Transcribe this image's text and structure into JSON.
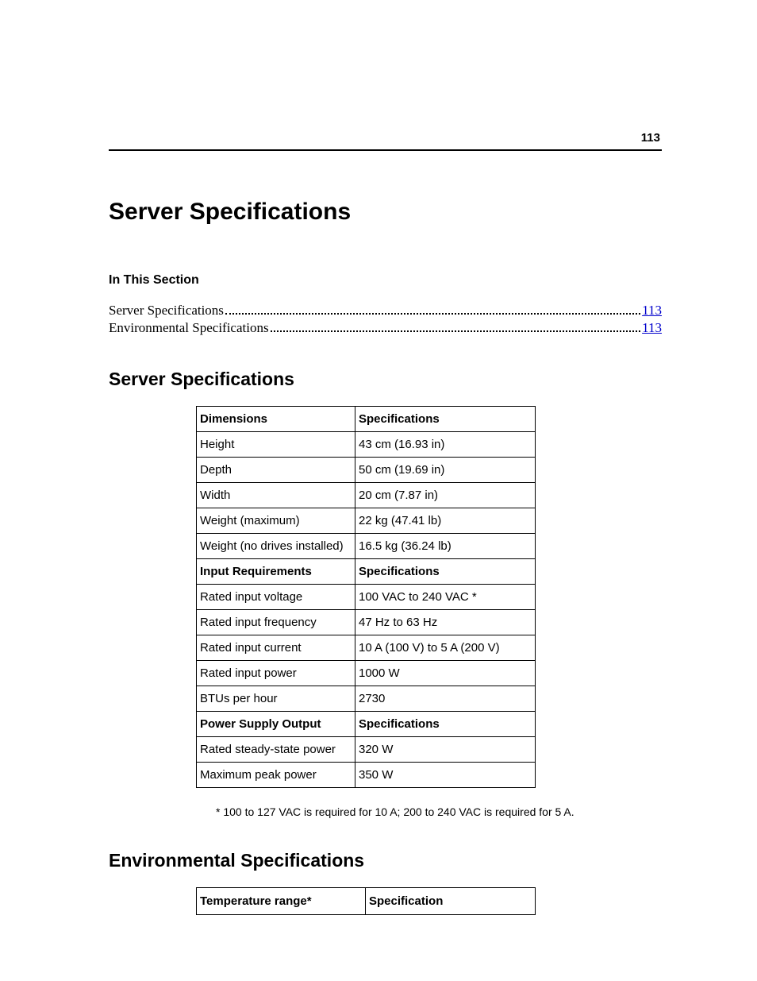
{
  "page_number": "113",
  "title": "Server Specifications",
  "in_this_section_label": "In This Section",
  "toc": [
    {
      "label": "Server Specifications",
      "page": "113"
    },
    {
      "label": "Environmental Specifications",
      "page": "113"
    }
  ],
  "heading_server_specs": "Server Specifications",
  "spec_table": [
    {
      "c1": "Dimensions",
      "c2": "Specifications",
      "header": true
    },
    {
      "c1": "Height",
      "c2": "43 cm (16.93 in)"
    },
    {
      "c1": "Depth",
      "c2": "50 cm (19.69 in)"
    },
    {
      "c1": "Width",
      "c2": "20 cm (7.87 in)"
    },
    {
      "c1": "Weight (maximum)",
      "c2": "22 kg (47.41 lb)"
    },
    {
      "c1": "Weight (no drives installed)",
      "c2": "16.5 kg (36.24 lb)"
    },
    {
      "c1": "Input Requirements",
      "c2": "Specifications",
      "header": true
    },
    {
      "c1": "Rated input voltage",
      "c2": "100 VAC to 240 VAC *"
    },
    {
      "c1": "Rated input frequency",
      "c2": "47 Hz to 63 Hz"
    },
    {
      "c1": "Rated input current",
      "c2": "10 A (100 V) to 5 A (200 V)"
    },
    {
      "c1": "Rated input power",
      "c2": "1000 W"
    },
    {
      "c1": "BTUs per hour",
      "c2": "2730"
    },
    {
      "c1": "Power Supply Output",
      "c2": "Specifications",
      "header": true
    },
    {
      "c1": "Rated steady-state power",
      "c2": "320 W"
    },
    {
      "c1": "Maximum peak power",
      "c2": "350 W"
    }
  ],
  "footnote": "* 100 to 127 VAC is required for 10 A; 200 to 240 VAC is required for 5 A.",
  "heading_env_specs": "Environmental Specifications",
  "env_table_headers": {
    "c1": "Temperature range*",
    "c2": "Specification"
  }
}
